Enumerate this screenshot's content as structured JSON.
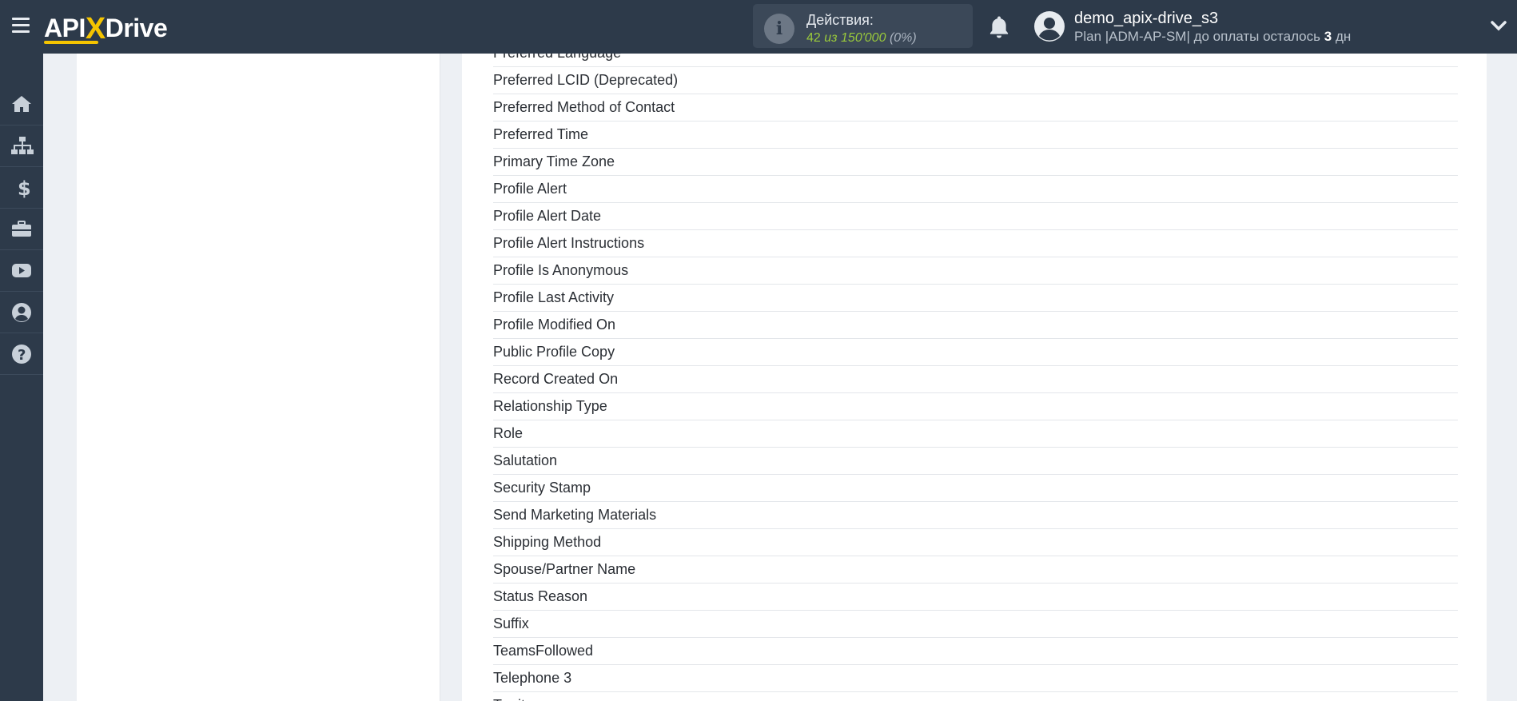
{
  "header": {
    "logo": {
      "api": "API",
      "x": "X",
      "drive": "Drive"
    },
    "actions": {
      "label": "Действия:",
      "count": "42",
      "of_text": "из 150'000",
      "percent": "(0%)"
    },
    "user": {
      "name": "demo_apix-drive_s3",
      "plan_prefix": "Plan |ADM-AP-SM| до оплаты осталось",
      "days": "3",
      "days_unit": "дн"
    }
  },
  "sidebar": {
    "items": [
      {
        "icon": "home-icon"
      },
      {
        "icon": "sitemap-icon"
      },
      {
        "icon": "dollar-icon"
      },
      {
        "icon": "briefcase-icon"
      },
      {
        "icon": "youtube-icon"
      },
      {
        "icon": "user-circle-icon"
      },
      {
        "icon": "help-icon"
      }
    ]
  },
  "fields": [
    "Preferred Language",
    "Preferred LCID (Deprecated)",
    "Preferred Method of Contact",
    "Preferred Time",
    "Primary Time Zone",
    "Profile Alert",
    "Profile Alert Date",
    "Profile Alert Instructions",
    "Profile Is Anonymous",
    "Profile Last Activity",
    "Profile Modified On",
    "Public Profile Copy",
    "Record Created On",
    "Relationship Type",
    "Role",
    "Salutation",
    "Security Stamp",
    "Send Marketing Materials",
    "Shipping Method",
    "Spouse/Partner Name",
    "Status Reason",
    "Suffix",
    "TeamsFollowed",
    "Telephone 3",
    "Territory"
  ],
  "colors": {
    "topbar": "#2d3a4a",
    "accent_yellow": "#f5c400",
    "count_green": "#9bcb3b",
    "page_bg": "#edf0f4"
  }
}
